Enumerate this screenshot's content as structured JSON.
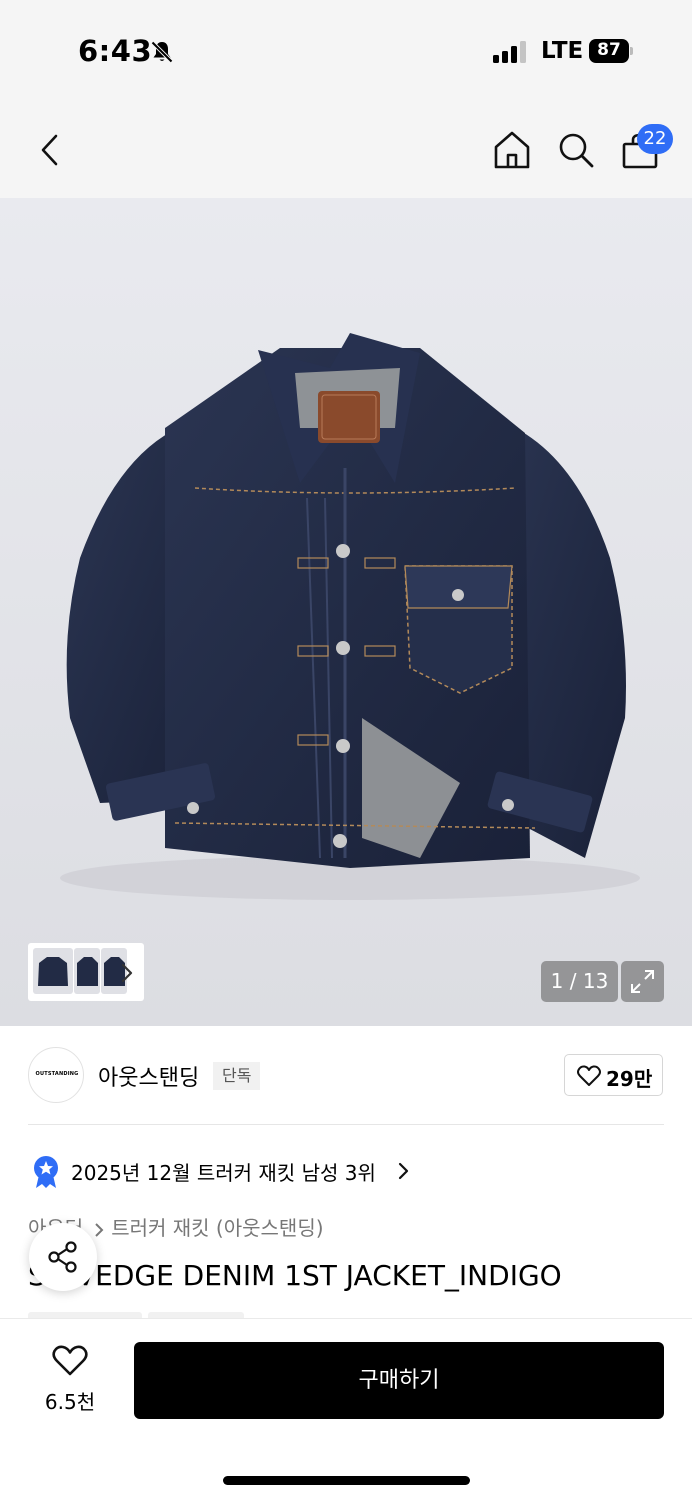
{
  "status_bar": {
    "time": "6:43",
    "network": "LTE",
    "battery": "87",
    "icons": [
      "bell-slash-icon",
      "signal-icon",
      "battery-icon"
    ]
  },
  "nav": {
    "icons": [
      "back-arrow-icon",
      "home-icon",
      "search-icon",
      "shopping-bag-icon"
    ],
    "cart_count": "22"
  },
  "gallery": {
    "page_indicator": "1 / 13",
    "icons": [
      "chevron-right-icon",
      "expand-icon"
    ]
  },
  "brand": {
    "logo_text": "OUTSTANDING",
    "name": "아웃스탠딩",
    "tag": "단독",
    "like_count": "29만"
  },
  "ranking": {
    "text": "2025년 12월 트러커 재킷 남성 3위"
  },
  "breadcrumb": {
    "category": "아우터",
    "subcategory": "트러커 재킷 (아웃스탠딩)"
  },
  "product": {
    "title": "SELVEDGE DENIM 1ST JACKET_INDIGO"
  },
  "bottom_bar": {
    "wish_count": "6.5천",
    "buy_label": "구매하기"
  },
  "colors": {
    "accent_badge": "#2f6df6",
    "buy_button": "#000000"
  }
}
